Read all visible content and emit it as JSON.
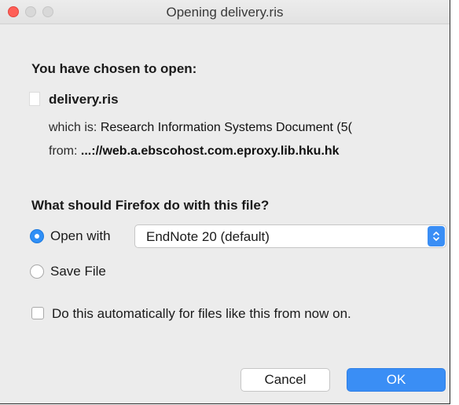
{
  "window": {
    "title": "Opening delivery.ris"
  },
  "dialog": {
    "heading": "You have chosen to open:",
    "filename": "delivery.ris",
    "which_is_label": "which is:",
    "which_is_value": "Research Information Systems Document (5(",
    "from_label": "from:",
    "from_value": "...://web.a.ebscohost.com.eproxy.lib.hku.hk",
    "question": "What should Firefox do with this file?",
    "open_with_label": "Open with",
    "open_with_selected": "EndNote 20 (default)",
    "save_file_label": "Save File",
    "auto_label": "Do this automatically for files like this from now on.",
    "selected_action": "open_with",
    "auto_checked": false
  },
  "buttons": {
    "cancel": "Cancel",
    "ok": "OK"
  },
  "colors": {
    "accent": "#3a8ef5",
    "close_light": "#ff5f57"
  }
}
